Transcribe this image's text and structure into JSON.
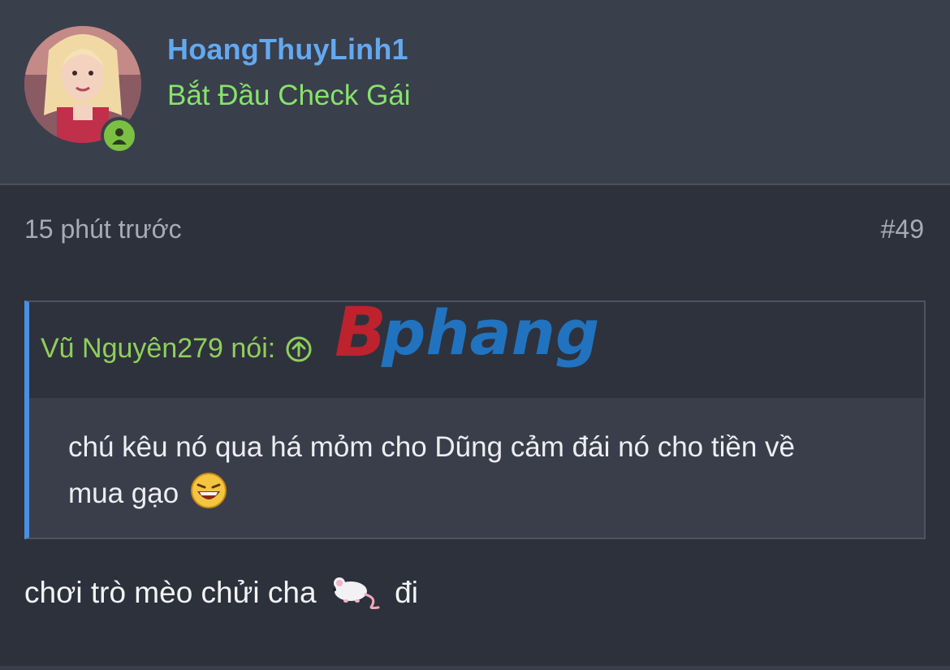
{
  "user": {
    "name": "HoangThuyLinh1",
    "title": "Bắt Đầu Check Gái",
    "status": "online"
  },
  "post": {
    "time": "15 phút trước",
    "number": "#49",
    "quote": {
      "author": "Vũ Nguyên279 nói:",
      "line1": "chú kêu nó qua há mỏm cho Dũng cảm đái nó cho tiền về",
      "line2": "mua gạo"
    },
    "body_before": "chơi trò mèo chửi cha",
    "body_after": "đi"
  },
  "watermark": {
    "letter": "B",
    "word": "phang"
  },
  "colors": {
    "username": "#63a9f0",
    "title": "#86e36a",
    "quote_author": "#8fcf5a",
    "quote_accent": "#4a90e2",
    "online": "#7bc043"
  },
  "icons": {
    "online": "user-online-icon",
    "jump": "arrow-up-circle-icon",
    "laugh": "laughing-emoji-icon",
    "mouse": "mouse-emoji-icon"
  }
}
